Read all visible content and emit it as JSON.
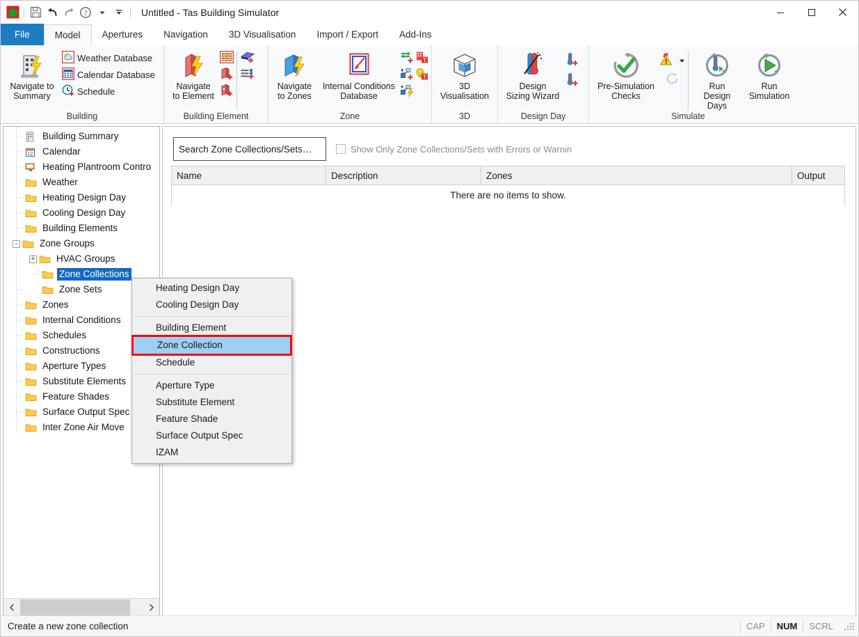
{
  "window": {
    "title": "Untitled - Tas Building Simulator",
    "quick_access": [
      {
        "name": "app-home-icon",
        "label": "Home"
      },
      {
        "name": "save-icon",
        "label": "Save"
      },
      {
        "name": "undo-icon",
        "label": "Undo"
      },
      {
        "name": "redo-icon",
        "label": "Redo"
      },
      {
        "name": "help-icon",
        "label": "Help"
      },
      {
        "name": "help-dropdown-icon",
        "label": "Help Options"
      },
      {
        "name": "customize-qat-icon",
        "label": "Customize Quick Access Toolbar"
      }
    ],
    "controls": {
      "minimize": "Minimize",
      "maximize": "Maximize",
      "close": "Close"
    }
  },
  "ribbon": {
    "tabs": [
      {
        "label": "File",
        "active": false,
        "file": true
      },
      {
        "label": "Model",
        "active": true
      },
      {
        "label": "Apertures",
        "active": false
      },
      {
        "label": "Navigation",
        "active": false
      },
      {
        "label": "3D Visualisation",
        "active": false
      },
      {
        "label": "Import / Export",
        "active": false
      },
      {
        "label": "Add-Ins",
        "active": false
      }
    ],
    "groups": [
      {
        "title": "Building",
        "big": {
          "label": "Navigate to\nSummary",
          "icon": "building-lightning-icon"
        },
        "small_items": [
          {
            "label": "Weather Database",
            "icon": "weather-database-icon"
          },
          {
            "label": "Calendar Database",
            "icon": "calendar-database-icon"
          },
          {
            "label": "Schedule",
            "icon": "schedule-add-icon"
          }
        ]
      },
      {
        "title": "Building Element",
        "big": {
          "label": "Navigate\nto Element",
          "icon": "element-lightning-icon"
        },
        "stack_a": [
          "construction-icon",
          "wall-add-icon",
          "aperture-add-icon"
        ],
        "stack_b": [
          "feature-shade-add-icon",
          "surface-output-spec-add-icon"
        ]
      },
      {
        "title": "Zone",
        "big": {
          "label": "Navigate\nto Zones",
          "icon": "zone-lightning-icon"
        },
        "big2": {
          "label": "Internal Conditions\nDatabase",
          "icon": "internal-conditions-icon"
        },
        "stack_a": [
          "izam-add-icon",
          "zone-set-add-icon",
          "zone-group-lightning-icon"
        ],
        "stack_b": [
          "building-type-icon",
          "lighting-type-icon"
        ]
      },
      {
        "title": "3D",
        "big": {
          "label": "3D\nVisualisation",
          "icon": "cube-3d-icon"
        }
      },
      {
        "title": "Design Day",
        "big": {
          "label": "Design\nSizing Wizard",
          "icon": "design-sizing-wizard-icon"
        },
        "stack_a": [
          "heating-design-day-add-icon",
          "cooling-design-day-add-icon"
        ]
      },
      {
        "title": "Simulate",
        "big": {
          "label": "Pre-Simulation\nChecks",
          "icon": "pre-simulation-checks-icon"
        },
        "stack_a": [
          "warning-icon",
          "warning-dropdown-icon",
          "refresh-icon"
        ],
        "big_extra": [
          {
            "label": "Run Design\nDays",
            "icon": "run-design-days-icon"
          },
          {
            "label": "Run\nSimulation",
            "icon": "run-simulation-icon"
          }
        ]
      }
    ]
  },
  "tree": {
    "nodes": [
      {
        "label": "Building Summary",
        "indent": 1,
        "icon": "building-summary-icon",
        "expander": "",
        "selected": false
      },
      {
        "label": "Calendar",
        "indent": 1,
        "icon": "calendar-icon",
        "expander": "",
        "selected": false
      },
      {
        "label": "Heating Plantroom Contro",
        "indent": 1,
        "icon": "plantroom-control-icon",
        "expander": "",
        "selected": false
      },
      {
        "label": "Weather",
        "indent": 1,
        "icon": "folder-icon",
        "expander": "",
        "selected": false
      },
      {
        "label": "Heating Design Day",
        "indent": 1,
        "icon": "folder-icon",
        "expander": "",
        "selected": false
      },
      {
        "label": "Cooling Design Day",
        "indent": 1,
        "icon": "folder-icon",
        "expander": "",
        "selected": false
      },
      {
        "label": "Building Elements",
        "indent": 1,
        "icon": "folder-icon",
        "expander": "",
        "selected": false
      },
      {
        "label": "Zone Groups",
        "indent": 1,
        "icon": "folder-icon",
        "expander": "-",
        "selected": false
      },
      {
        "label": "HVAC Groups",
        "indent": 2,
        "icon": "folder-icon",
        "expander": "+",
        "selected": false
      },
      {
        "label": "Zone Collections",
        "indent": 2,
        "icon": "folder-icon",
        "expander": "",
        "selected": true
      },
      {
        "label": "Zone Sets",
        "indent": 2,
        "icon": "folder-icon",
        "expander": "",
        "selected": false
      },
      {
        "label": "Zones",
        "indent": 1,
        "icon": "folder-icon",
        "expander": "",
        "selected": false
      },
      {
        "label": "Internal Conditions",
        "indent": 1,
        "icon": "folder-icon",
        "expander": "",
        "selected": false
      },
      {
        "label": "Schedules",
        "indent": 1,
        "icon": "folder-icon",
        "expander": "",
        "selected": false
      },
      {
        "label": "Constructions",
        "indent": 1,
        "icon": "folder-icon",
        "expander": "",
        "selected": false
      },
      {
        "label": "Aperture Types",
        "indent": 1,
        "icon": "folder-icon",
        "expander": "",
        "selected": false
      },
      {
        "label": "Substitute Elements",
        "indent": 1,
        "icon": "folder-icon",
        "expander": "",
        "selected": false
      },
      {
        "label": "Feature Shades",
        "indent": 1,
        "icon": "folder-icon",
        "expander": "",
        "selected": false
      },
      {
        "label": "Surface Output Spec",
        "indent": 1,
        "icon": "folder-icon",
        "expander": "",
        "selected": false
      },
      {
        "label": "Inter Zone Air Move",
        "indent": 1,
        "icon": "folder-icon",
        "expander": "",
        "selected": false
      }
    ],
    "scroll_left_icon": "chevron-left-icon",
    "scroll_right_icon": "chevron-right-icon"
  },
  "main": {
    "search": {
      "value": "Search Zone Collections/Sets…",
      "placeholder": "Search Zone Collections/Sets…"
    },
    "filter_checkbox": {
      "label": "Show Only Zone Collections/Sets with Errors or Warnin",
      "checked": false
    },
    "grid": {
      "columns": [
        "Name",
        "Description",
        "Zones",
        "Output"
      ],
      "rows": [],
      "empty_message": "There are no items to show."
    }
  },
  "context_menu": {
    "items": [
      {
        "label": "Heating Design Day",
        "highlight": false,
        "separator_after": false
      },
      {
        "label": "Cooling Design Day",
        "highlight": false,
        "separator_after": true
      },
      {
        "label": "Building Element",
        "highlight": false,
        "separator_after": false
      },
      {
        "label": "Zone Collection",
        "highlight": true,
        "separator_after": false
      },
      {
        "label": "Schedule",
        "highlight": false,
        "separator_after": true
      },
      {
        "label": "Aperture Type",
        "highlight": false,
        "separator_after": false
      },
      {
        "label": "Substitute Element",
        "highlight": false,
        "separator_after": false
      },
      {
        "label": "Feature Shade",
        "highlight": false,
        "separator_after": false
      },
      {
        "label": "Surface Output Spec",
        "highlight": false,
        "separator_after": false
      },
      {
        "label": "IZAM",
        "highlight": false,
        "separator_after": false
      }
    ],
    "highlight_color": "#ff0000",
    "highlight_fill": "#9cd0f5"
  },
  "statusbar": {
    "message": "Create a new zone collection",
    "indicators": [
      {
        "label": "CAP",
        "active": false
      },
      {
        "label": "NUM",
        "active": true
      },
      {
        "label": "SCRL",
        "active": false
      }
    ]
  },
  "colors": {
    "accent_blue": "#1e7bc4",
    "selection_blue": "#1669c1",
    "ribbon_bg": "#f7f9fb",
    "menu_bg": "#f0f0f0",
    "highlight_red": "#ff0000"
  }
}
